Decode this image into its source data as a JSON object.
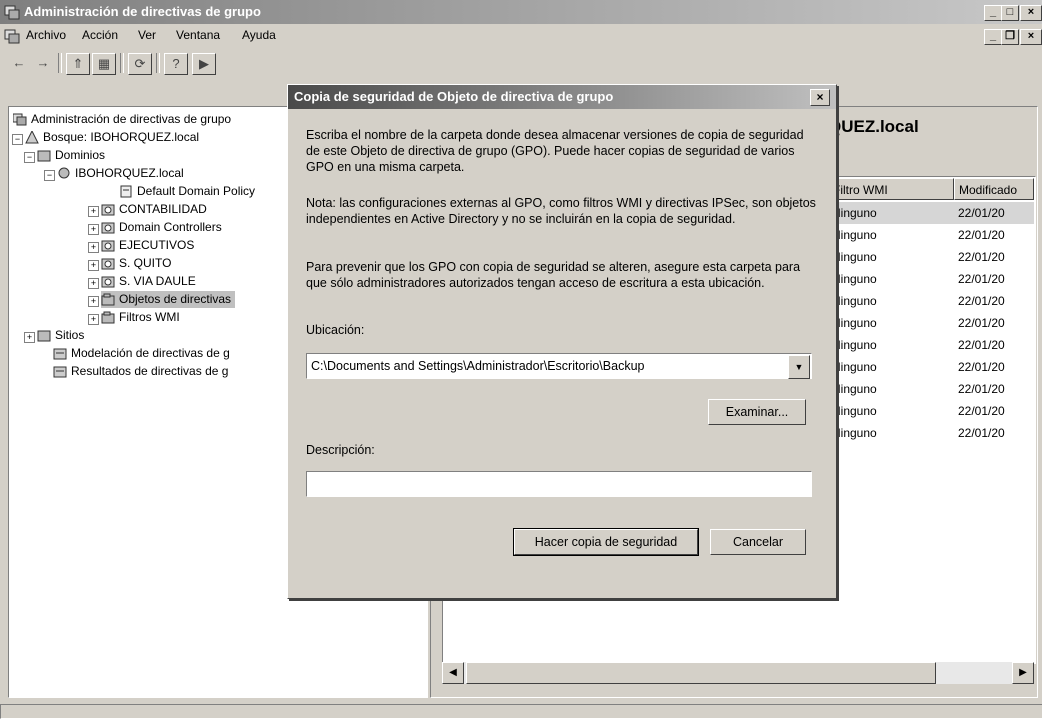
{
  "window": {
    "title": "Administración de directivas de grupo"
  },
  "menu": {
    "items": [
      "Archivo",
      "Acción",
      "Ver",
      "Ventana",
      "Ayuda"
    ]
  },
  "tree": {
    "root": "Administración de directivas de grupo",
    "forest": "Bosque: IBOHORQUEZ.local",
    "domains": "Dominios",
    "domain": "IBOHORQUEZ.local",
    "default_policy": "Default Domain Policy",
    "ous": [
      "CONTABILIDAD",
      "Domain Controllers",
      "EJECUTIVOS",
      "S. QUITO",
      "S. VIA DAULE"
    ],
    "gpo_objects": "Objetos de directivas",
    "wmi_filters": "Filtros WMI",
    "sites": "Sitios",
    "modeling": "Modelación de directivas de g",
    "results": "Resultados de directivas de g"
  },
  "right": {
    "heading": "QUEZ.local",
    "columns": [
      "Filtro WMI",
      "Modificado"
    ],
    "rows": [
      [
        "Ninguno",
        "22/01/20"
      ],
      [
        "Ninguno",
        "22/01/20"
      ],
      [
        "Ninguno",
        "22/01/20"
      ],
      [
        "Ninguno",
        "22/01/20"
      ],
      [
        "Ninguno",
        "22/01/20"
      ],
      [
        "Ninguno",
        "22/01/20"
      ],
      [
        "Ninguno",
        "22/01/20"
      ],
      [
        "Ninguno",
        "22/01/20"
      ],
      [
        "Ninguno",
        "22/01/20"
      ],
      [
        "Ninguno",
        "22/01/20"
      ],
      [
        "Ninguno",
        "22/01/20"
      ]
    ]
  },
  "dialog": {
    "title": "Copia de seguridad de Objeto de directiva de grupo",
    "para1": "Escriba el nombre de la carpeta donde desea almacenar versiones de copia de seguridad de este Objeto de directiva de grupo (GPO). Puede hacer copias de seguridad de varios GPO en una misma carpeta.",
    "para2": "Nota: las configuraciones externas al GPO, como filtros WMI y directivas IPSec, son objetos independientes en Active Directory y no se incluirán en la copia de seguridad.",
    "para3": "Para prevenir que los GPO con copia de seguridad se alteren, asegure esta carpeta para que sólo administradores autorizados tengan acceso de escritura a esta ubicación.",
    "location_label": "Ubicación:",
    "location_value": "C:\\Documents and Settings\\Administrador\\Escritorio\\Backup",
    "browse_label": "Examinar...",
    "description_label": "Descripción:",
    "description_value": "",
    "backup_button": "Hacer copia de seguridad",
    "cancel_button": "Cancelar"
  }
}
